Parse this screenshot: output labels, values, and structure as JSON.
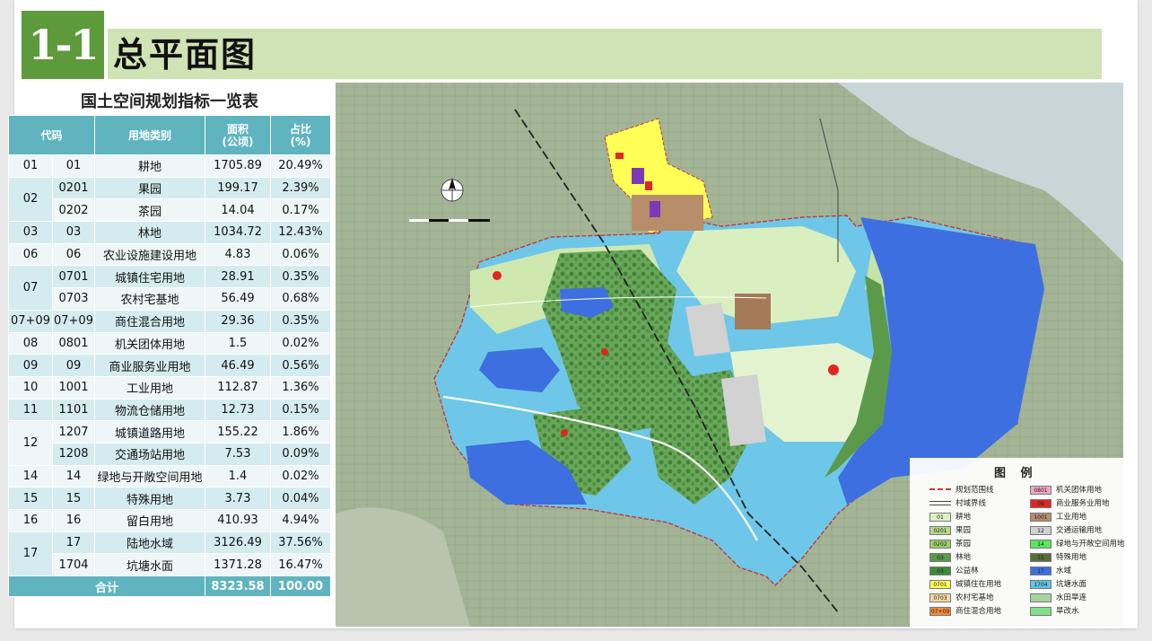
{
  "header": {
    "number": "1-1",
    "title": "总平面图"
  },
  "table": {
    "title": "国土空间规划指标一览表",
    "headers": {
      "code": "代码",
      "category": "用地类别",
      "area": "面积\n(公顷)",
      "ratio": "占比\n(%)"
    },
    "rows": [
      {
        "group": "01",
        "code": "01",
        "name": "耕地",
        "area": "1705.89",
        "ratio": "20.49%"
      },
      {
        "group": "02",
        "code": "0201",
        "name": "果园",
        "area": "199.17",
        "ratio": "2.39%"
      },
      {
        "group": "",
        "code": "0202",
        "name": "茶园",
        "area": "14.04",
        "ratio": "0.17%"
      },
      {
        "group": "03",
        "code": "03",
        "name": "林地",
        "area": "1034.72",
        "ratio": "12.43%"
      },
      {
        "group": "06",
        "code": "06",
        "name": "农业设施建设用地",
        "area": "4.83",
        "ratio": "0.06%"
      },
      {
        "group": "07",
        "code": "0701",
        "name": "城镇住宅用地",
        "area": "28.91",
        "ratio": "0.35%"
      },
      {
        "group": "",
        "code": "0703",
        "name": "农村宅基地",
        "area": "56.49",
        "ratio": "0.68%"
      },
      {
        "group": "07+09",
        "code": "07+09",
        "name": "商住混合用地",
        "area": "29.36",
        "ratio": "0.35%"
      },
      {
        "group": "08",
        "code": "0801",
        "name": "机关团体用地",
        "area": "1.5",
        "ratio": "0.02%"
      },
      {
        "group": "09",
        "code": "09",
        "name": "商业服务业用地",
        "area": "46.49",
        "ratio": "0.56%"
      },
      {
        "group": "10",
        "code": "1001",
        "name": "工业用地",
        "area": "112.87",
        "ratio": "1.36%"
      },
      {
        "group": "11",
        "code": "1101",
        "name": "物流仓储用地",
        "area": "12.73",
        "ratio": "0.15%"
      },
      {
        "group": "12",
        "code": "1207",
        "name": "城镇道路用地",
        "area": "155.22",
        "ratio": "1.86%"
      },
      {
        "group": "",
        "code": "1208",
        "name": "交通场站用地",
        "area": "7.53",
        "ratio": "0.09%"
      },
      {
        "group": "14",
        "code": "14",
        "name": "绿地与开敞空间用地",
        "area": "1.4",
        "ratio": "0.02%"
      },
      {
        "group": "15",
        "code": "15",
        "name": "特殊用地",
        "area": "3.73",
        "ratio": "0.04%"
      },
      {
        "group": "16",
        "code": "16",
        "name": "留白用地",
        "area": "410.93",
        "ratio": "4.94%"
      },
      {
        "group": "17",
        "code": "17",
        "name": "陆地水域",
        "area": "3126.49",
        "ratio": "37.56%"
      },
      {
        "group": "",
        "code": "1704",
        "name": "坑塘水面",
        "area": "1371.28",
        "ratio": "16.47%"
      }
    ],
    "total": {
      "label": "合计",
      "area": "8323.58",
      "ratio": "100.00"
    }
  },
  "legend": {
    "title": "图 例",
    "left": [
      {
        "code": "",
        "label": "规划范围线",
        "color": "boundary"
      },
      {
        "code": "",
        "label": "村域界线",
        "color": "line"
      },
      {
        "code": "01",
        "label": "耕地",
        "color": "#dff2c2"
      },
      {
        "code": "0201",
        "label": "果园",
        "color": "#b8d98a"
      },
      {
        "code": "0202",
        "label": "茶园",
        "color": "#9ccf6b"
      },
      {
        "code": "03",
        "label": "林地",
        "color": "#5a9a4a"
      },
      {
        "code": "03",
        "label": "公益林",
        "color": "#3e8a3a"
      },
      {
        "code": "0701",
        "label": "城镇住在用地",
        "color": "#ffff55"
      },
      {
        "code": "0703",
        "label": "农村宅基地",
        "color": "#f5d7a0"
      },
      {
        "code": "07+09",
        "label": "商住混合用地",
        "color": "#f08c3c"
      }
    ],
    "right": [
      {
        "code": "0801",
        "label": "机关团体用地",
        "color": "#f2a6c4"
      },
      {
        "code": "09",
        "label": "商业服务业用地",
        "color": "#e0261e"
      },
      {
        "code": "1001",
        "label": "工业用地",
        "color": "#b88d6a"
      },
      {
        "code": "12",
        "label": "交通运输用地",
        "color": "#d2d2d2"
      },
      {
        "code": "14",
        "label": "绿地与开敞空间用地",
        "color": "#58e85a"
      },
      {
        "code": "15",
        "label": "特殊用地",
        "color": "#5a6e3a"
      },
      {
        "code": "17",
        "label": "水域",
        "color": "#3e6fe0"
      },
      {
        "code": "1704",
        "label": "坑塘水面",
        "color": "#5fc6e6"
      },
      {
        "code": "",
        "label": "水田旱连",
        "color": "#a8d4a0"
      },
      {
        "code": "",
        "label": "旱改水",
        "color": "#7ee08a"
      }
    ]
  },
  "colors": {
    "accent": "#5d9a3c",
    "title_bar": "#cfe3b4",
    "table_header": "#5fb4c0"
  }
}
